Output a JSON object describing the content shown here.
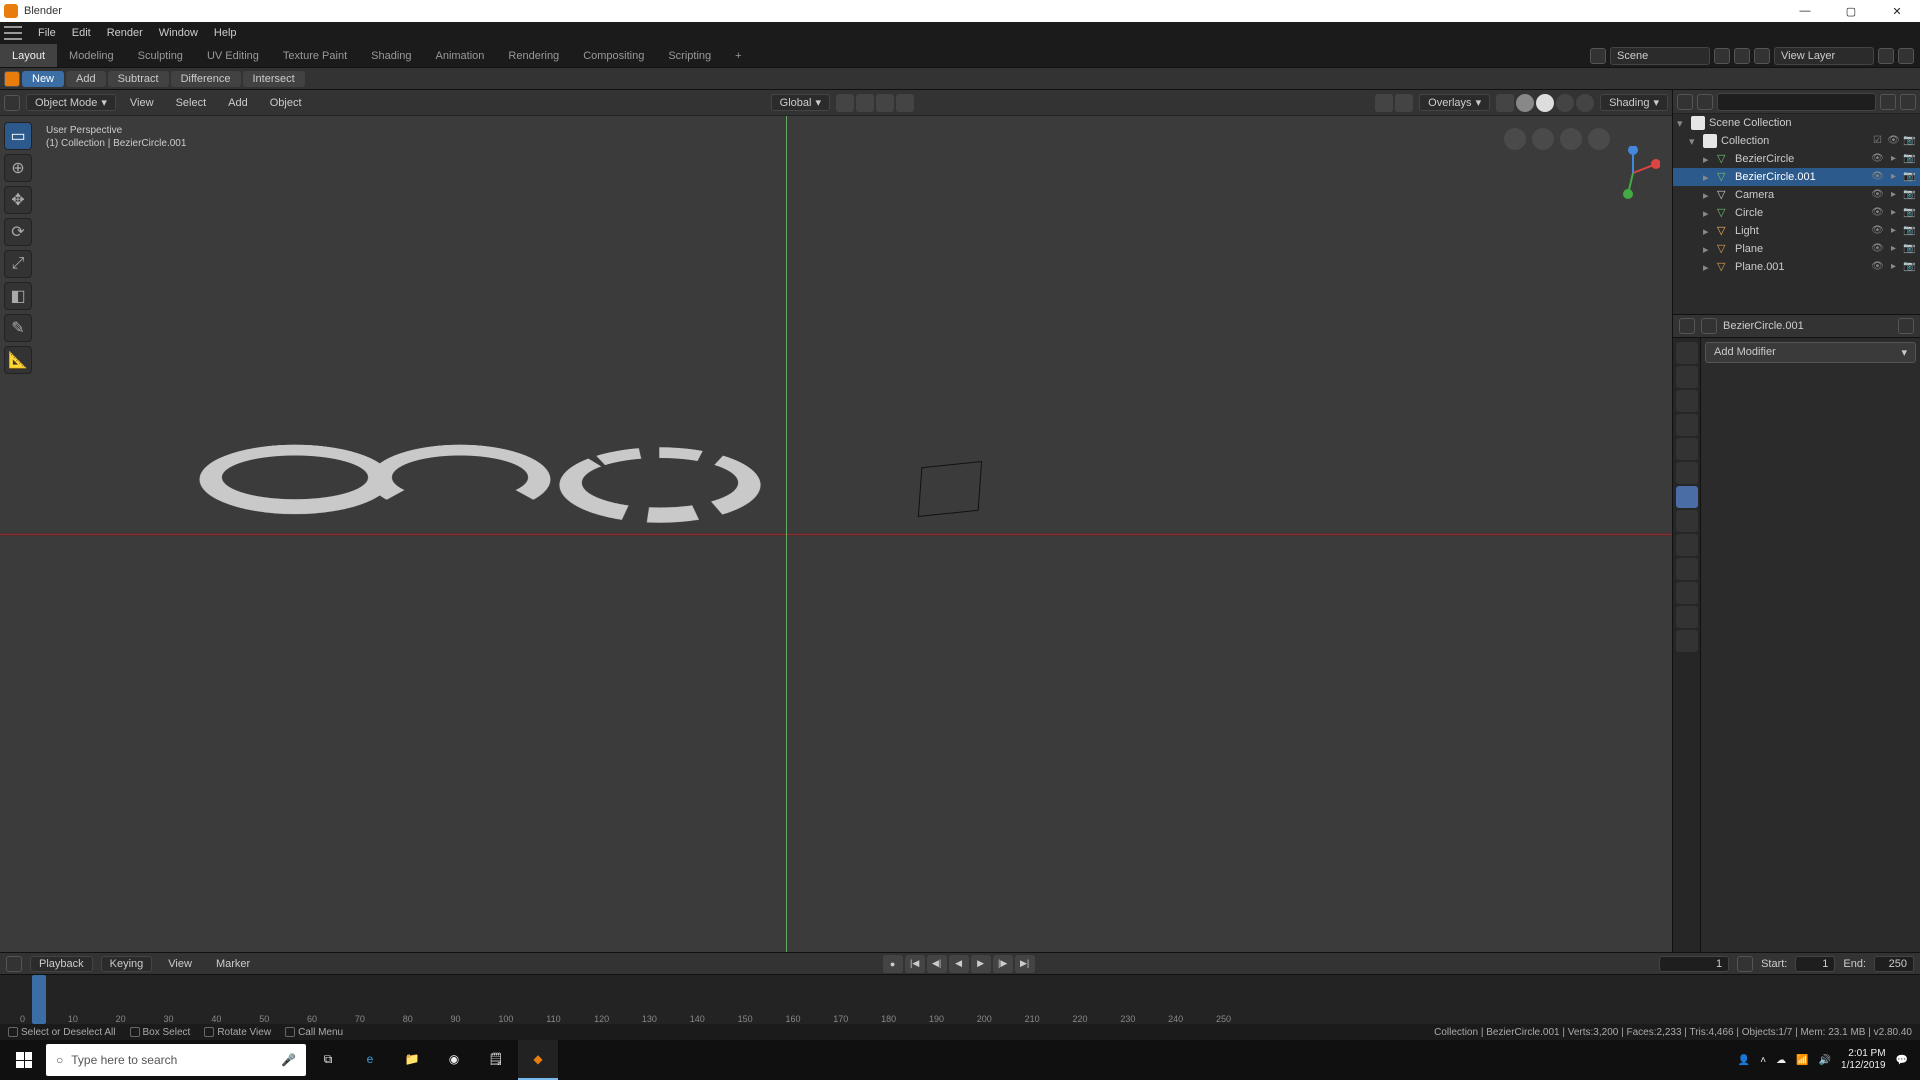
{
  "title": "Blender",
  "menus": [
    "File",
    "Edit",
    "Render",
    "Window",
    "Help"
  ],
  "workspaces": {
    "tabs": [
      "Layout",
      "Modeling",
      "Sculpting",
      "UV Editing",
      "Texture Paint",
      "Shading",
      "Animation",
      "Rendering",
      "Compositing",
      "Scripting"
    ],
    "active": "Layout",
    "add_label": "+"
  },
  "scene_field": "Scene",
  "layer_field": "View Layer",
  "tool_options": {
    "mode_label": "New",
    "ops": [
      "Add",
      "Subtract",
      "Difference",
      "Intersect"
    ]
  },
  "viewport_header": {
    "mode": "Object Mode",
    "menus": [
      "View",
      "Select",
      "Add",
      "Object"
    ],
    "orientation": "Global",
    "overlays_label": "Overlays",
    "shading_label": "Shading"
  },
  "viewport_info": {
    "line1": "User Perspective",
    "line2": "(1)  Collection | BezierCircle.001"
  },
  "outliner": {
    "root": "Scene Collection",
    "collection": "Collection",
    "items": [
      {
        "name": "BezierCircle",
        "icon": "curve"
      },
      {
        "name": "BezierCircle.001",
        "icon": "curve",
        "selected": true
      },
      {
        "name": "Camera",
        "icon": "cam"
      },
      {
        "name": "Circle",
        "icon": "curve"
      },
      {
        "name": "Light",
        "icon": "light"
      },
      {
        "name": "Plane",
        "icon": "mesh"
      },
      {
        "name": "Plane.001",
        "icon": "mesh"
      }
    ]
  },
  "properties": {
    "context_label": "BezierCircle.001",
    "add_modifier": "Add Modifier"
  },
  "timeline": {
    "menus": [
      "Playback",
      "Keying",
      "View",
      "Marker"
    ],
    "current": "1",
    "start_label": "Start:",
    "start": "1",
    "end_label": "End:",
    "end": "250",
    "ticks": [
      "0",
      "10",
      "20",
      "30",
      "40",
      "50",
      "60",
      "70",
      "80",
      "90",
      "100",
      "110",
      "120",
      "130",
      "140",
      "150",
      "160",
      "170",
      "180",
      "190",
      "200",
      "210",
      "220",
      "230",
      "240",
      "250"
    ]
  },
  "status": {
    "hints": [
      {
        "icon": "mouse",
        "text": "Select or Deselect All"
      },
      {
        "icon": "mouse",
        "text": "Box Select"
      },
      {
        "icon": "mouse",
        "text": "Rotate View"
      },
      {
        "icon": "mouse",
        "text": "Call Menu"
      }
    ],
    "stats": "Collection | BezierCircle.001 | Verts:3,200 | Faces:2,233 | Tris:4,466 | Objects:1/7 | Mem: 23.1 MB | v2.80.40"
  },
  "taskbar": {
    "search_placeholder": "Type here to search",
    "time": "2:01 PM",
    "date": "1/12/2019"
  }
}
